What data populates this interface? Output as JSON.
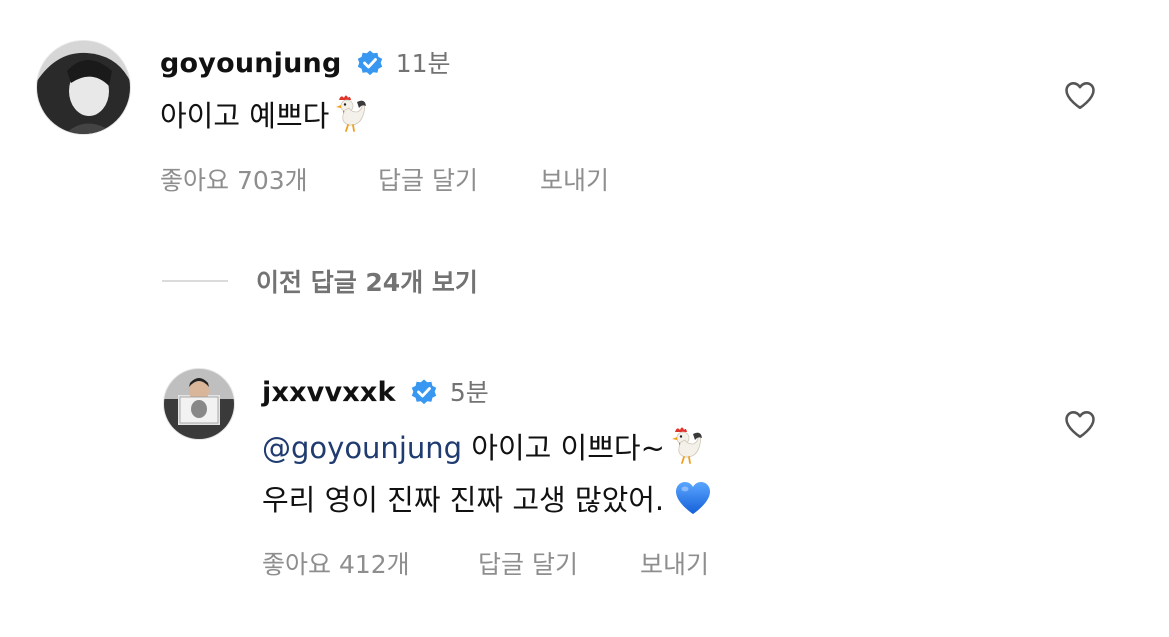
{
  "comments": [
    {
      "username": "goyounjung",
      "time": "11분",
      "text": "아이고 예쁘다",
      "emoji": "rooster-emoji",
      "likes_label": "좋아요 703개",
      "reply_label": "답글 달기",
      "send_label": "보내기"
    }
  ],
  "replies_toggle": {
    "label": "이전 답글 24개 보기"
  },
  "reply": {
    "username": "jxxvvxxk",
    "time": "5분",
    "mention": "@goyounjung",
    "line1_text": " 아이고 이쁘다~",
    "line1_emoji": "rooster-emoji",
    "line2_text": "우리 영이 진짜 진짜 고생 많았어. ",
    "line2_emoji": "blue-heart-emoji",
    "likes_label": "좋아요 412개",
    "reply_label": "답글 달기",
    "send_label": "보내기"
  },
  "colors": {
    "verified": "#3897f0",
    "mention": "#1f3b6f",
    "muted": "#8e8e8e"
  }
}
